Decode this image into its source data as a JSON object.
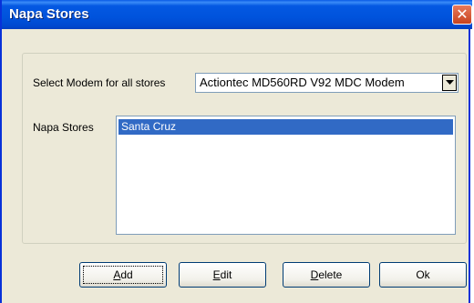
{
  "window": {
    "title": "Napa Stores",
    "close_glyph": "✕"
  },
  "modem": {
    "label": "Select Modem for all stores",
    "selected": "Actiontec MD560RD V92 MDC Modem"
  },
  "stores": {
    "label": "Napa Stores",
    "items": [
      "Santa Cruz"
    ]
  },
  "buttons": {
    "add": {
      "ul": "A",
      "rest": "dd"
    },
    "edit": {
      "ul": "E",
      "rest": "dit"
    },
    "delete": {
      "ul": "D",
      "rest": "elete"
    },
    "ok": {
      "ul": "",
      "rest": "Ok"
    }
  },
  "colors": {
    "titlebar": "#0053dc",
    "selection": "#316ac5",
    "face": "#ece9d8"
  }
}
